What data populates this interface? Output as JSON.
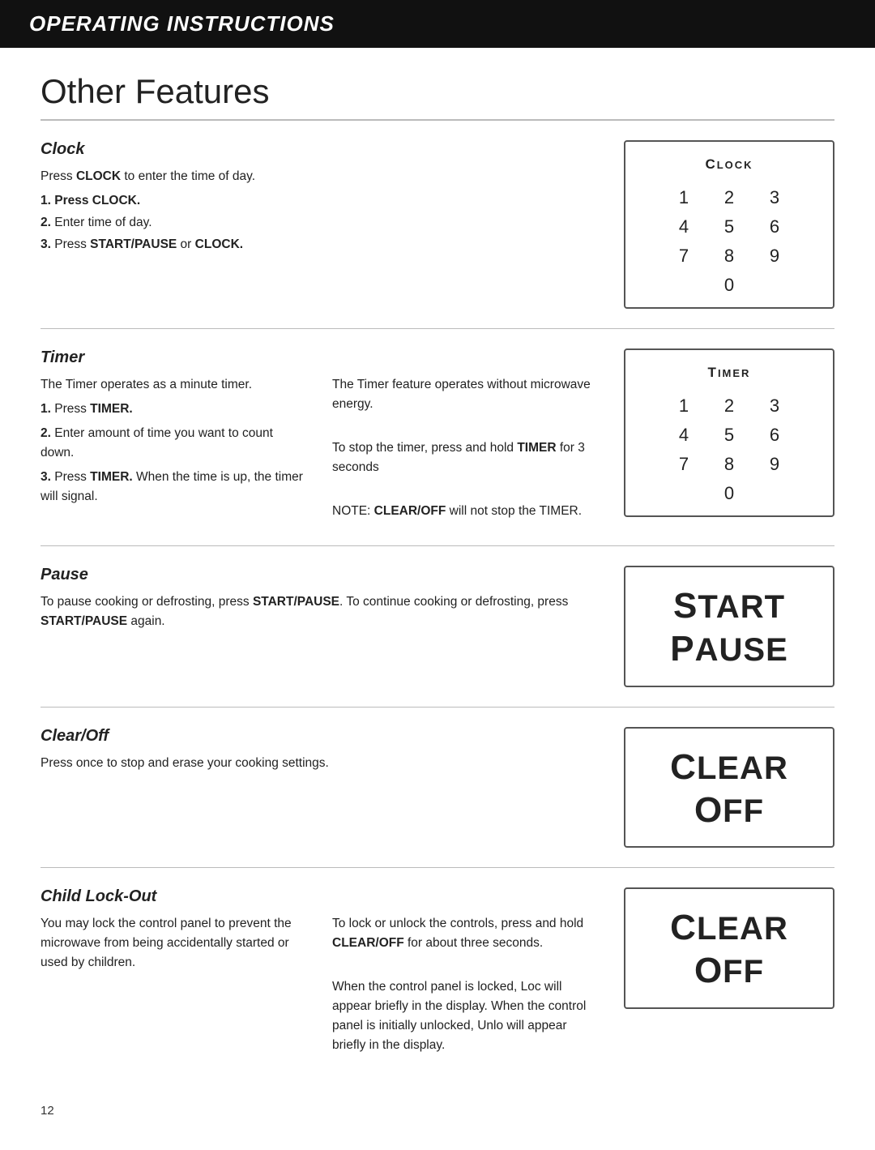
{
  "header": {
    "title": "Operating Instructions"
  },
  "page_title": "Other Features",
  "sections": [
    {
      "id": "clock",
      "title": "Clock",
      "intro": "Press CLOCK to enter the time of day.",
      "intro_bold_word": "CLOCK",
      "steps": [
        {
          "num": "1.",
          "bold": "Press CLOCK."
        },
        {
          "num": "2.",
          "text": "Enter time of day."
        },
        {
          "num": "3.",
          "bold": "Press START/PAUSE",
          "text": " or ",
          "bold2": "CLOCK."
        }
      ],
      "panel": {
        "type": "keypad",
        "label": "Clock",
        "keys": [
          "1",
          "2",
          "3",
          "4",
          "5",
          "6",
          "7",
          "8",
          "9",
          "0"
        ]
      }
    },
    {
      "id": "timer",
      "title": "Timer",
      "left_text": [
        "The Timer operates as a minute timer.",
        "1. Press TIMER.",
        "2. Enter amount of time you want to count down.",
        "3. Press TIMER. When the time is up, the timer will signal."
      ],
      "right_text": [
        "The Timer feature operates without microwave energy.",
        "To stop the timer, press and hold TIMER for 3 seconds",
        "NOTE: CLEAR/OFF will not stop the TIMER."
      ],
      "panel": {
        "type": "keypad",
        "label": "Timer",
        "keys": [
          "1",
          "2",
          "3",
          "4",
          "5",
          "6",
          "7",
          "8",
          "9",
          "0"
        ]
      }
    },
    {
      "id": "pause",
      "title": "Pause",
      "text": "To pause cooking or defrosting, press START/PAUSE. To continue cooking or defrosting, press START/PAUSE again.",
      "panel": {
        "type": "start-pause",
        "line1": "Start",
        "line2": "Pause"
      }
    },
    {
      "id": "clear-off",
      "title": "Clear/Off",
      "text": "Press once to stop and erase your cooking settings.",
      "panel": {
        "type": "clear-off",
        "line1": "Clear",
        "line2": "Off"
      }
    },
    {
      "id": "child-lock",
      "title": "Child Lock-Out",
      "left_text": "You may lock the control panel to prevent the microwave from being accidentally started or used by children.",
      "right_text": "To lock or unlock the controls, press and hold CLEAR/OFF for about three seconds.\n\nWhen the control panel is locked, Loc will appear briefly in the display. When the control panel is initially unlocked, Unlo will appear briefly in the display.",
      "panel": {
        "type": "clear-off",
        "line1": "Clear",
        "line2": "Off"
      }
    }
  ],
  "page_number": "12"
}
